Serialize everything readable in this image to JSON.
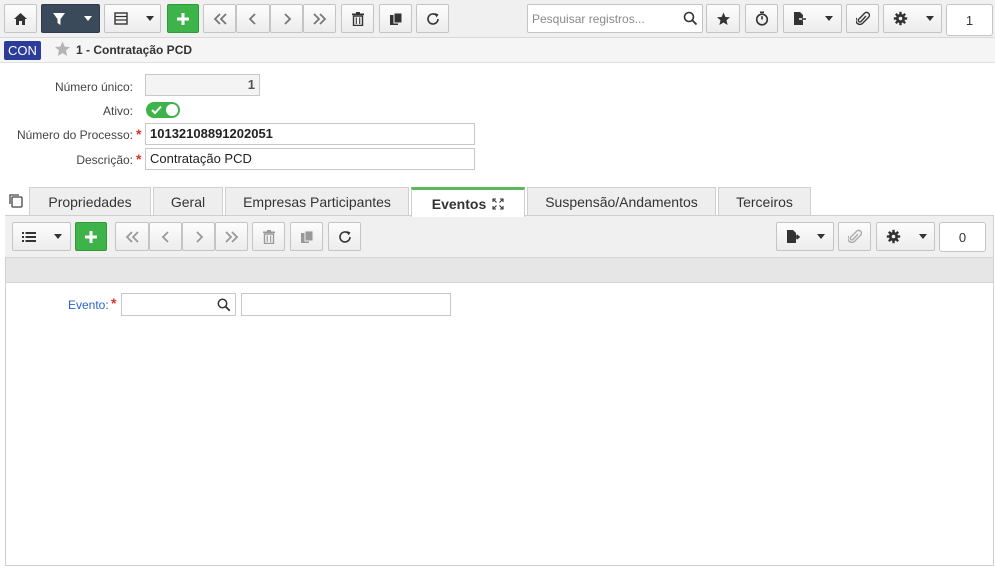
{
  "toolbar": {
    "search_placeholder": "Pesquisar registros...",
    "page_counter": "1"
  },
  "titlebar": {
    "badge": "CON",
    "title": "1 - Contratação PCD"
  },
  "form": {
    "numero_unico": {
      "label": "Número único:",
      "value": "1"
    },
    "ativo": {
      "label": "Ativo:",
      "checked": true
    },
    "numero_processo": {
      "label": "Número do Processo:",
      "required_mark": "*",
      "value": "10132108891202051"
    },
    "descricao": {
      "label": "Descrição:",
      "required_mark": "*",
      "value": "Contratação PCD"
    }
  },
  "tabs": [
    {
      "label": "Propriedades",
      "active": false
    },
    {
      "label": "Geral",
      "active": false
    },
    {
      "label": "Empresas Participantes",
      "active": false
    },
    {
      "label": "Eventos",
      "active": true
    },
    {
      "label": "Suspensão/Andamentos",
      "active": false
    },
    {
      "label": "Terceiros",
      "active": false
    }
  ],
  "subtoolbar": {
    "counter": "0"
  },
  "evento": {
    "label": "Evento:",
    "required_mark": "*",
    "code_value": "",
    "desc_value": ""
  },
  "colors": {
    "accent_green": "#3eb34a",
    "dark_filter": "#3a4a5a",
    "badge_blue": "#2b3c9b",
    "required_red": "#d9342b",
    "link_blue": "#2a64c7"
  }
}
